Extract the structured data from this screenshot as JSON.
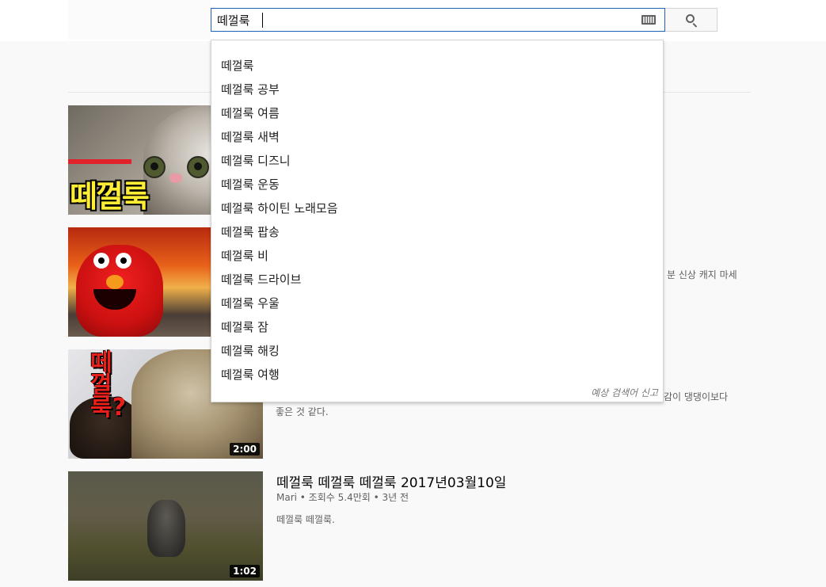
{
  "search": {
    "query": "떼껄룩",
    "placeholder": "",
    "keyboard_icon": "keyboard-icon",
    "search_icon": "search-icon"
  },
  "autocomplete": {
    "items": [
      "떼껄룩",
      "떼껄룩 공부",
      "떼껄룩 여름",
      "떼껄룩 새벽",
      "떼껄룩 디즈니",
      "떼껄룩 운동",
      "떼껄룩 하이틴 노래모음",
      "떼껄룩 팝송",
      "떼껄룩 비",
      "떼껄룩 드라이브",
      "떼껄룩 우울",
      "떼껄룩 잠",
      "떼껄룩 해킹",
      "떼껄룩 여행"
    ],
    "report_label": "예상 검색어 신고"
  },
  "results": [
    {
      "thumb_text": "떼껄룩",
      "desc_fragment": ""
    },
    {
      "desc_fragment": "분 신상 캐지 마세"
    },
    {
      "thumb_text": "떼껄룩?",
      "duration": "2:00",
      "desc_fragment": "감이 댕댕이보다",
      "desc_line2": "좋은 것 같다."
    },
    {
      "title": "떼껄룩 떼껄룩 떼껄룩 2017년03월10일",
      "meta": "Mari • 조회수 5.4만회 • 3년 전",
      "description": "떼껄룩 떼껄룩.",
      "duration": "1:02"
    }
  ],
  "colors": {
    "search_border": "#1c62b9",
    "background": "#f9f9f9"
  }
}
